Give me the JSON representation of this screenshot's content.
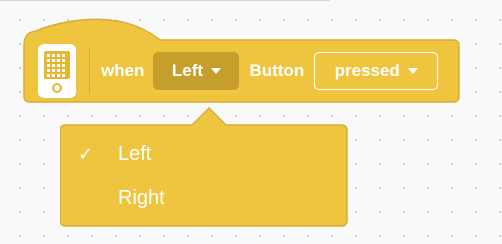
{
  "block": {
    "when_label": "when",
    "button_choice": "Left",
    "button_label": "Button",
    "event_choice": "pressed"
  },
  "menu": {
    "items": [
      {
        "label": "Left",
        "selected": true,
        "check_glyph": "✓"
      },
      {
        "label": "Right",
        "selected": false,
        "check_glyph": ""
      }
    ]
  },
  "colors": {
    "block_fill": "#efc43f",
    "block_border": "#d6ad35",
    "dropdown_active": "#c59e2c",
    "text": "#ffffff",
    "canvas": "#f9f9f9"
  },
  "icons": {
    "device": "brain-device-icon",
    "caret": "caret-down-icon",
    "check": "checkmark-icon"
  }
}
